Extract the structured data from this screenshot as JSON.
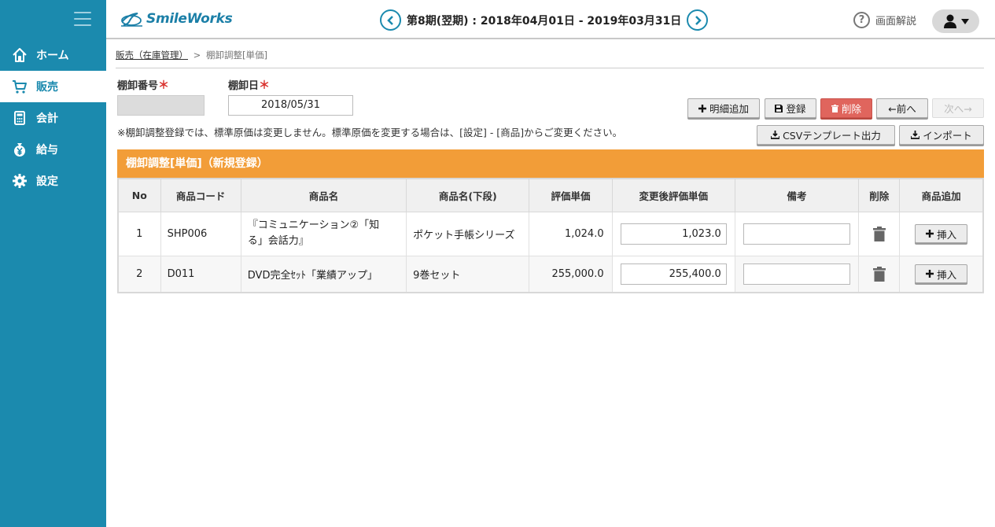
{
  "header": {
    "logo_text": "SmileWorks",
    "period_text": "第8期(翌期) : 2018年04月01日 - 2019年03月31日",
    "help_label": "画面解説"
  },
  "sidebar": {
    "items": [
      {
        "label": "ホーム",
        "icon": "home-icon"
      },
      {
        "label": "販売",
        "icon": "cart-icon"
      },
      {
        "label": "会計",
        "icon": "calculator-icon"
      },
      {
        "label": "給与",
        "icon": "yen-bag-icon"
      },
      {
        "label": "設定",
        "icon": "gear-icon"
      }
    ],
    "active_index": 1
  },
  "breadcrumb": {
    "parent": "販売（在庫管理）",
    "separator": ">",
    "current": "棚卸調整[単価]"
  },
  "form": {
    "number_label": "棚卸番号",
    "number_value": "",
    "date_label": "棚卸日",
    "date_value": "2018/05/31",
    "required_mark": "＊",
    "note": "※棚卸調整登録では、標準原価は変更しません。標準原価を変更する場合は、[設定] - [商品]からご変更ください。"
  },
  "toolbar": {
    "add_detail": "明細追加",
    "save": "登録",
    "delete": "削除",
    "prev": "←前へ",
    "next": "次へ→",
    "csv_template": "CSVテンプレート出力",
    "import": "インポート"
  },
  "panel": {
    "title": "棚卸調整[単価]（新規登録）"
  },
  "table": {
    "columns": [
      "No",
      "商品コード",
      "商品名",
      "商品名(下段)",
      "評価単価",
      "変更後評価単価",
      "備考",
      "削除",
      "商品追加"
    ],
    "rows": [
      {
        "no": "1",
        "code": "SHP006",
        "name": "『コミュニケーション②「知る」会話力』",
        "name2": "ポケット手帳シリーズ",
        "unit_price": "1,024.0",
        "new_price": "1,023.0",
        "note": "",
        "insert": "挿入"
      },
      {
        "no": "2",
        "code": "D011",
        "name": "DVD完全ｾｯﾄ「業績アップ」",
        "name2": "9巻セット",
        "unit_price": "255,000.0",
        "new_price": "255,400.0",
        "note": "",
        "insert": "挿入"
      }
    ]
  },
  "colors": {
    "sidebar": "#1b8aae",
    "panel_header": "#f29d38",
    "delete_button": "#e0655d",
    "required": "#d9322e"
  }
}
